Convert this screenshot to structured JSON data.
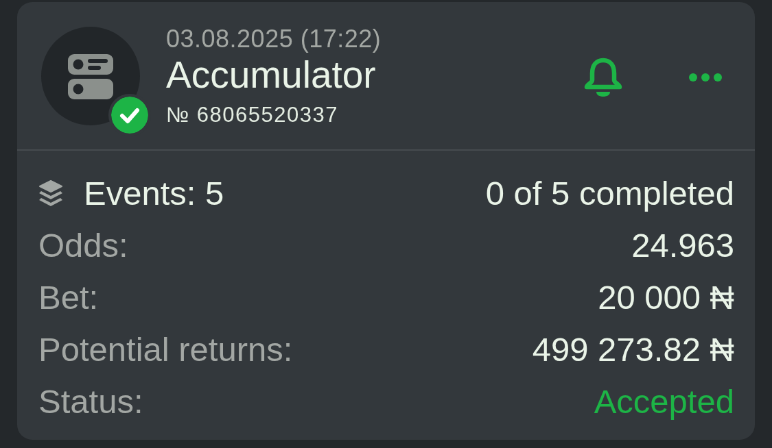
{
  "bet": {
    "date": "03.08.2025 (17:22)",
    "title": "Accumulator",
    "number": "№ 68065520337"
  },
  "events": {
    "label": "Events: 5",
    "progress": "0 of 5 completed"
  },
  "details": [
    {
      "kind": "plain",
      "label": "Odds:",
      "value": "24.963"
    },
    {
      "kind": "plain",
      "label": "Bet:",
      "value": "20 000 ₦"
    },
    {
      "kind": "plain",
      "label": "Potential returns:",
      "value": "499 273.82 ₦"
    },
    {
      "kind": "status",
      "label": "Status:",
      "value": "Accepted"
    }
  ]
}
